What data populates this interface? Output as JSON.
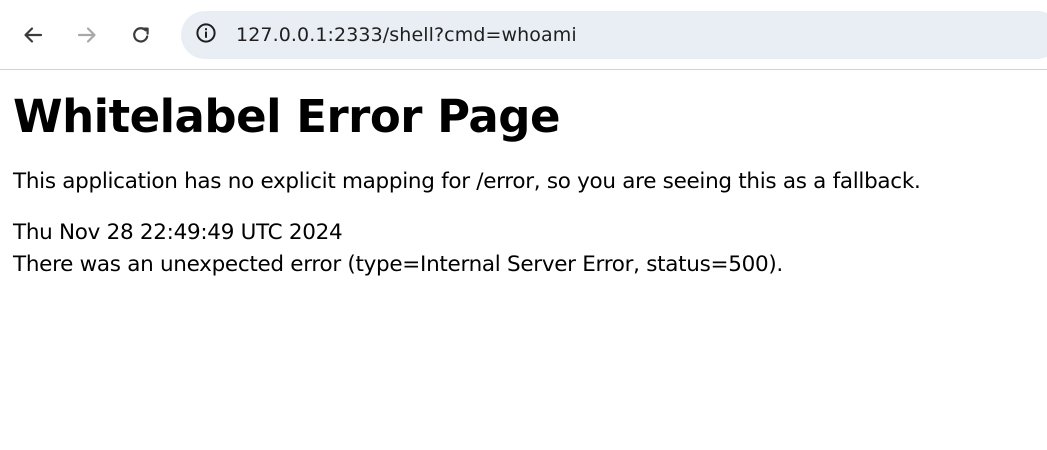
{
  "browser": {
    "url": "127.0.0.1:2333/shell?cmd=whoami",
    "icons": {
      "back": "arrow-left-icon",
      "forward": "arrow-right-icon",
      "reload": "reload-icon",
      "site_info": "info-icon"
    }
  },
  "page": {
    "title": "Whitelabel Error Page",
    "fallback_message": "This application has no explicit mapping for /error, so you are seeing this as a fallback.",
    "timestamp": "Thu Nov 28 22:49:49 UTC 2024",
    "error_message": "There was an unexpected error (type=Internal Server Error, status=500)."
  }
}
